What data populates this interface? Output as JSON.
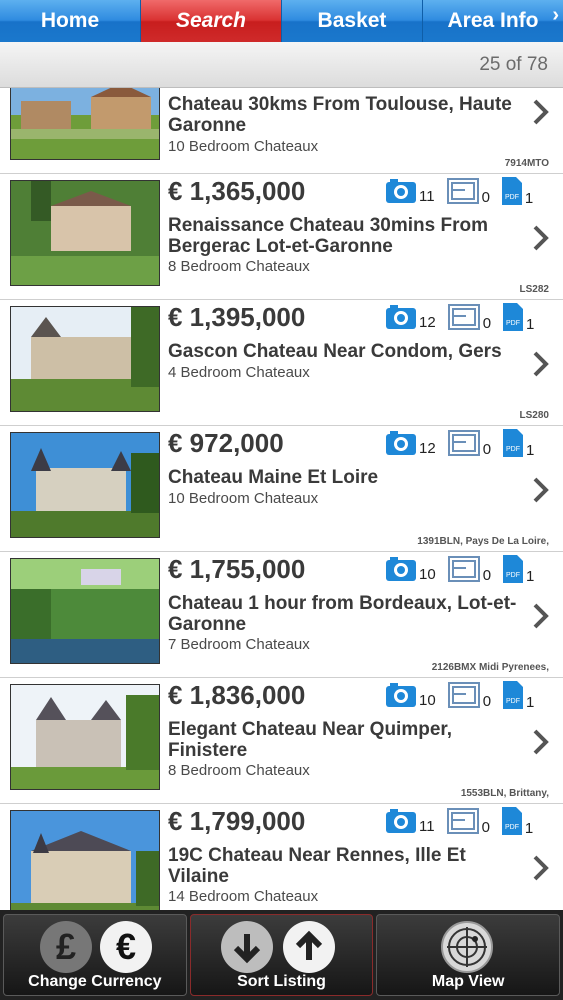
{
  "tabs": {
    "home": "Home",
    "search": "Search",
    "basket": "Basket",
    "area_info": "Area Info"
  },
  "counter": "25 of 78",
  "listings": [
    {
      "price": "",
      "title": "Chateau 30kms From Toulouse, Haute Garonne",
      "subtitle": "10 Bedroom Chateaux",
      "ref": "7914MTO"
    },
    {
      "price": "€ 1,365,000",
      "title": "Renaissance Chateau 30mins From Bergerac Lot-et-Garonne",
      "subtitle": "8 Bedroom Chateaux",
      "ref": "LS282",
      "photos": "11",
      "plans": "0",
      "pdfs": "1"
    },
    {
      "price": "€ 1,395,000",
      "title": "Gascon Chateau Near Condom, Gers",
      "subtitle": "4 Bedroom Chateaux",
      "ref": "LS280",
      "photos": "12",
      "plans": "0",
      "pdfs": "1"
    },
    {
      "price": "€ 972,000",
      "title": "Chateau Maine Et Loire",
      "subtitle": "10 Bedroom Chateaux",
      "ref": "1391BLN, Pays De La Loire,",
      "photos": "12",
      "plans": "0",
      "pdfs": "1"
    },
    {
      "price": "€ 1,755,000",
      "title": "Chateau 1 hour from Bordeaux, Lot-et-Garonne",
      "subtitle": "7 Bedroom Chateaux",
      "ref": "2126BMX Midi Pyrenees,",
      "photos": "10",
      "plans": "0",
      "pdfs": "1"
    },
    {
      "price": "€ 1,836,000",
      "title": "Elegant Chateau Near Quimper, Finistere",
      "subtitle": "8 Bedroom Chateaux",
      "ref": "1553BLN, Brittany,",
      "photos": "10",
      "plans": "0",
      "pdfs": "1"
    },
    {
      "price": "€ 1,799,000",
      "title": "19C Chateau Near Rennes, Ille Et Vilaine",
      "subtitle": "14 Bedroom Chateaux",
      "ref": "",
      "photos": "11",
      "plans": "0",
      "pdfs": "1"
    }
  ],
  "toolbar": {
    "change_currency": "Change Currency",
    "sort_listing": "Sort Listing",
    "map_view": "Map View",
    "pound_symbol": "£",
    "euro_symbol": "€"
  },
  "colors": {
    "tab_blue": "#2f8be0",
    "tab_active_red": "#d93232",
    "icon_blue": "#1e88d8"
  },
  "icons": {
    "photo": "camera-icon",
    "plan": "floorplan-icon",
    "pdf": "pdf-icon",
    "chevron": "chevron-right-icon"
  }
}
